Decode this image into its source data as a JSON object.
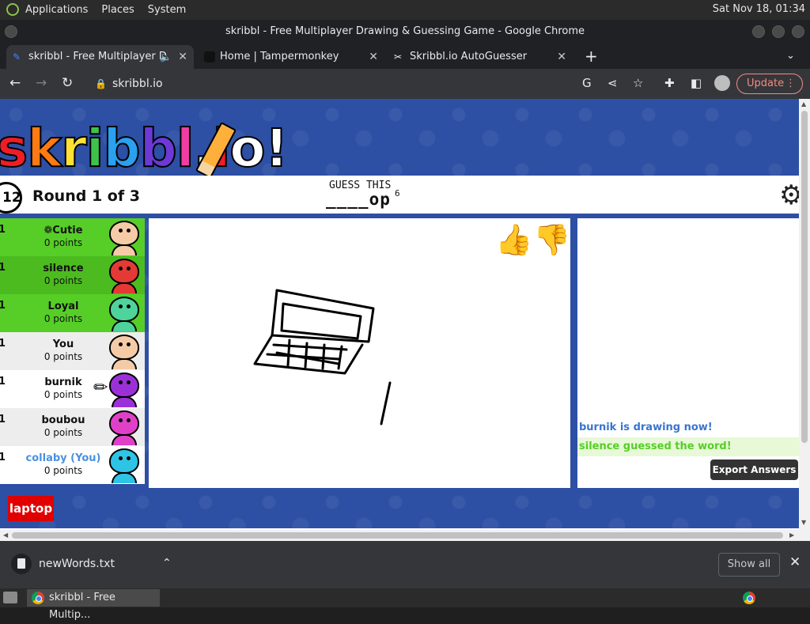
{
  "os": {
    "menus": [
      "Applications",
      "Places",
      "System"
    ],
    "clock": "Sat Nov 18, 01:34"
  },
  "window": {
    "title": "skribbl - Free Multiplayer Drawing & Guessing Game - Google Chrome"
  },
  "tabs": [
    {
      "label": "skribbl - Free Multiplayer D",
      "icon": "pencil-icon"
    },
    {
      "label": "Home | Tampermonkey",
      "icon": "tampermonkey-icon"
    },
    {
      "label": "Skribbl.io AutoGuesser",
      "icon": "script-icon"
    }
  ],
  "toolbar": {
    "url": "skribbl.io",
    "update_label": "Update"
  },
  "game": {
    "logo": "skribbl.io",
    "timer": "12",
    "round": "Round 1 of 3",
    "guess_label": "GUESS THIS",
    "word_hint": "____op",
    "word_length": "6",
    "players": [
      {
        "rank": "1",
        "name": "❁Cutie",
        "points": "0 points",
        "bg": "#56ce27",
        "skin": "#f5cba7"
      },
      {
        "rank": "1",
        "name": "silence",
        "points": "0 points",
        "bg": "#4cbb1f",
        "skin": "#e53935"
      },
      {
        "rank": "1",
        "name": "Loyal",
        "points": "0 points",
        "bg": "#56ce27",
        "skin": "#4ed39a"
      },
      {
        "rank": "1",
        "name": "You",
        "points": "0 points",
        "bg": "#ededed",
        "skin": "#f5cba7"
      },
      {
        "rank": "1",
        "name": "burnik",
        "points": "0 points",
        "bg": "#ffffff",
        "skin": "#9b30d9"
      },
      {
        "rank": "1",
        "name": "boubou",
        "points": "0 points",
        "bg": "#ededed",
        "skin": "#e040c8"
      },
      {
        "rank": "1",
        "name": "collaby (You)",
        "points": "0 points",
        "bg": "#ffffff",
        "skin": "#2ec4e6",
        "name_color": "#4a90e2"
      }
    ],
    "chat": [
      {
        "text": "burnik is drawing now!",
        "color": "#3975ce",
        "bg": "#ffffff"
      },
      {
        "text": "silence guessed the word!",
        "color": "#56ce27",
        "bg": "#e7f9d7"
      }
    ],
    "export_label": "Export Answers",
    "answer_tag": "laptop"
  },
  "downloads": {
    "file": "newWords.txt",
    "show_all": "Show all"
  },
  "taskbar": {
    "task": "skribbl - Free Multip..."
  }
}
